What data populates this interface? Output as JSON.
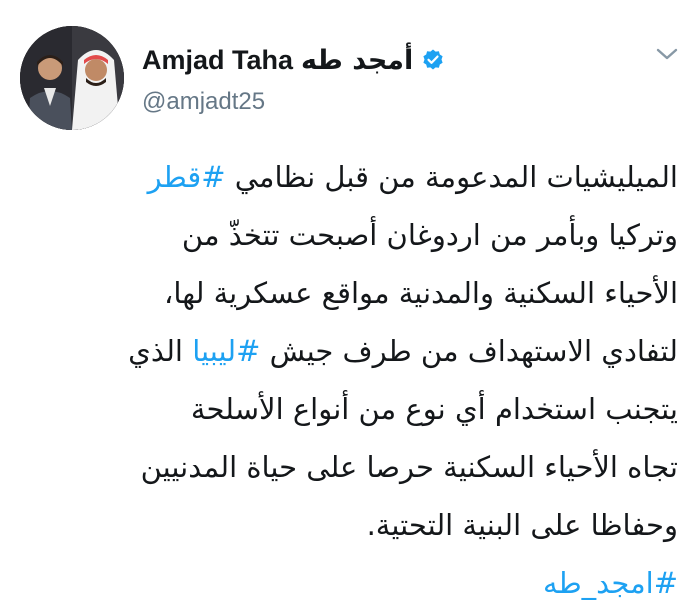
{
  "author": {
    "display_name_en": "Amjad Taha",
    "display_name_ar": "أمجد طه",
    "handle": "@amjadt25",
    "verified": true
  },
  "tweet": {
    "line1": {
      "text": "الميليشيات المدعومة من قبل نظامي ",
      "hashtag": "#قطر"
    },
    "line2": "وتركيا وبأمر من اردوغان أصبحت تتخذّ من",
    "line3": "الأحياء السكنية والمدنية مواقع عسكرية لها،",
    "line4": {
      "before": "لتفادي الاستهداف من طرف جيش ",
      "hashtag": "#ليبيا",
      "after": " الذي"
    },
    "line5": "يتجنب استخدام أي نوع من أنواع الأسلحة",
    "line6": "تجاه الأحياء السكنية حرصا على حياة المدنيين",
    "line7": "وحفاظا على البنية التحتية.",
    "line8": {
      "hashtag": "#امجد_طه"
    }
  },
  "icons": {
    "verified": "verified-badge-icon",
    "menu": "chevron-down-icon"
  },
  "colors": {
    "link": "#1da1f2",
    "text": "#14171a",
    "secondary": "#657786"
  }
}
